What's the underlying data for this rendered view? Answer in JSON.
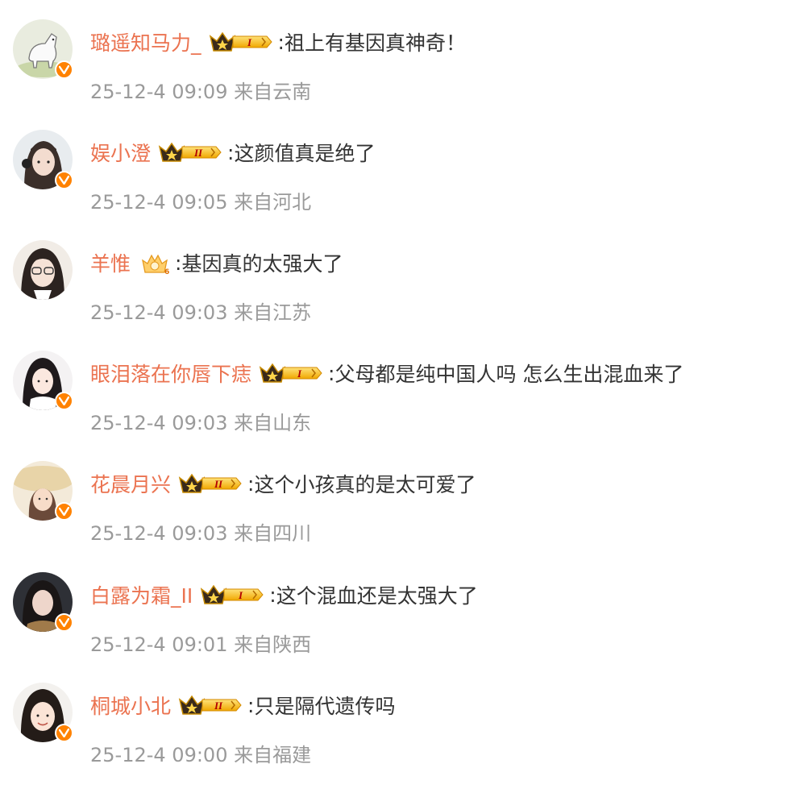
{
  "comments": [
    {
      "username": "璐遥知马力_",
      "text": "祖上有基因真神奇！",
      "time": "25-12-4 09:09",
      "location": "来自云南",
      "badge": "crown-badge-level-1",
      "avatar": "white-horse-avatar"
    },
    {
      "username": "娱小澄",
      "text": "这颜值真是绝了",
      "time": "25-12-4 09:05",
      "location": "来自河北",
      "badge": "crown-badge-level-2",
      "avatar": "girl-headphones-avatar"
    },
    {
      "username": "羊惟",
      "text": "基因真的太强大了",
      "time": "25-12-4 09:03",
      "location": "来自江苏",
      "badge": "fan-medal-6",
      "avatar": "girl-glasses-avatar"
    },
    {
      "username": "眼泪落在你唇下痣",
      "text": "父母都是纯中国人吗 怎么生出混血来了",
      "time": "25-12-4 09:03",
      "location": "来自山东",
      "badge": "crown-badge-level-1",
      "avatar": "girl-long-hair-avatar"
    },
    {
      "username": "花晨月兴",
      "text": "这个小孩真的是太可爱了",
      "time": "25-12-4 09:03",
      "location": "来自四川",
      "badge": "crown-badge-level-2",
      "avatar": "girl-straw-hat-avatar"
    },
    {
      "username": "白露为霜_II",
      "text": "这个混血还是太强大了",
      "time": "25-12-4 09:01",
      "location": "来自陕西",
      "badge": "crown-badge-level-1",
      "avatar": "girl-dark-hair-avatar"
    },
    {
      "username": "桐城小北",
      "text": "只是隔代遗传吗",
      "time": "25-12-4 09:00",
      "location": "来自福建",
      "badge": "crown-badge-level-2",
      "avatar": "girl-smiling-avatar"
    }
  ],
  "colors": {
    "username": "#eb7350",
    "text": "#333333",
    "meta": "#9a9a9a",
    "verified_badge": "#ff8200"
  }
}
